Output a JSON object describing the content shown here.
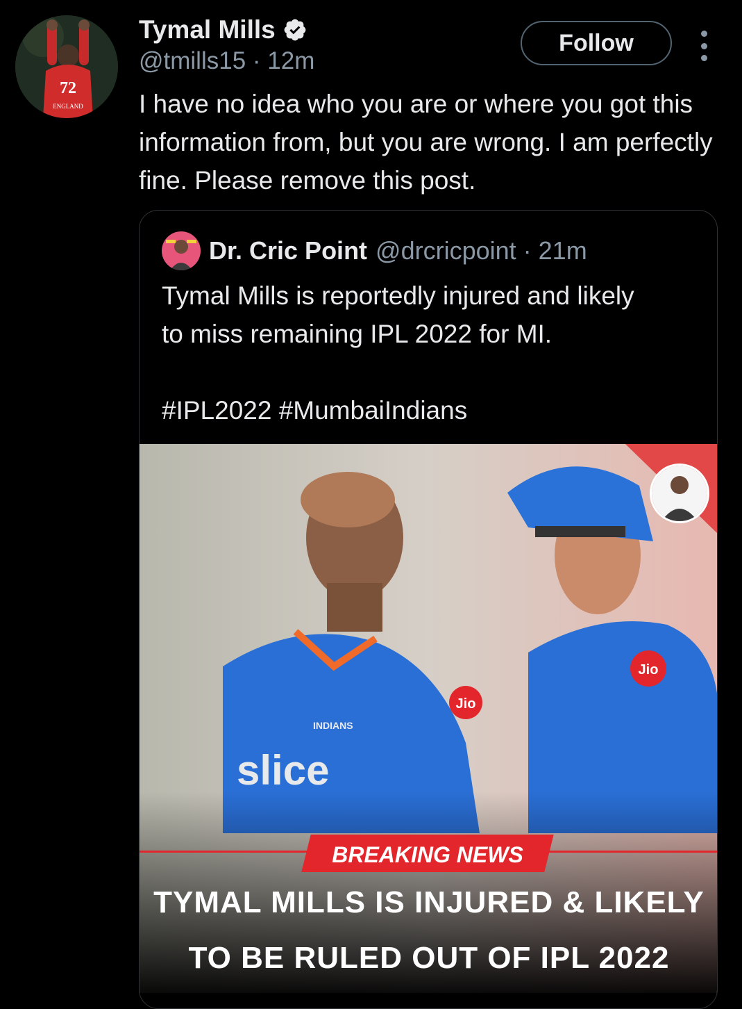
{
  "tweet": {
    "author_name": "Tymal Mills",
    "handle_time": "@tmills15 · 12m",
    "follow_label": "Follow",
    "text": "I have no idea who you are or where you got this information from, but you are wrong. I am perfectly fine. Please remove this post.",
    "avatar_jersey_number": "72",
    "avatar_jersey_text": "ENGLAND"
  },
  "quoted": {
    "author_name": "Dr. Cric Point",
    "handle_time": "@drcricpoint · 21m",
    "text": "Tymal Mills is reportedly injured and likely\nto miss remaining IPL 2022 for MI.\n\n#IPL2022 #MumbaiIndians",
    "media": {
      "banner": "BREAKING NEWS",
      "headline": "TYMAL MILLS IS INJURED & LIKELY\nTO BE RULED OUT OF IPL 2022",
      "shirt_sponsor": "slice",
      "shirt_logo": "Jio",
      "team": "INDIANS"
    }
  },
  "colors": {
    "background": "#000000",
    "text": "#e7e9ea",
    "secondary": "#8b98a5",
    "verified": "#e7e9ea",
    "banner_red": "#e3262b",
    "jersey_blue": "#2a6fd6"
  }
}
